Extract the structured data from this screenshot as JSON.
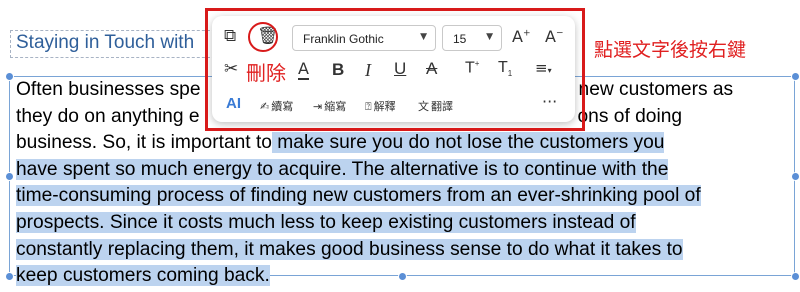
{
  "slide": {
    "title": "Staying in Touch with",
    "body_lines": [
      {
        "pre": "Often businesses spe",
        "sel": "",
        "post": "new customers as",
        "gap": true
      },
      {
        "pre": "they do on anything e",
        "sel": "",
        "post": "ons of doing",
        "gap": true
      },
      {
        "pre": "business. So, it is important to",
        "sel": " make sure you do not lose the customers you",
        "post": ""
      },
      {
        "pre": "",
        "sel": "have spent so much energy to acquire. The alternative is to continue with the",
        "post": ""
      },
      {
        "pre": "",
        "sel": "time-consuming process of finding new customers from an ever-shrinking pool of",
        "post": ""
      },
      {
        "pre": "",
        "sel": "prospects. Since it costs much less to keep existing customers instead of",
        "post": ""
      },
      {
        "pre": "",
        "sel": "constantly replacing them, it makes good business sense to do what it takes to",
        "post": ""
      },
      {
        "pre": "",
        "sel": "keep customers coming back.",
        "post": ""
      }
    ]
  },
  "toolbar": {
    "font_name": "Franklin Gothic",
    "font_size": "15",
    "icons": {
      "copy": "copy-icon",
      "delete": "trash-icon",
      "cut": "scissors-icon",
      "underline_color": "font-color-icon",
      "bold": "B",
      "italic": "I",
      "underline": "U",
      "strikethrough": "A",
      "superscript": "superscript-icon",
      "subscript": "subscript-icon",
      "align": "align-icon",
      "grow": "A+",
      "shrink": "A-",
      "ai": "AI",
      "more": "···"
    },
    "ai_actions": [
      "續寫",
      "縮寫",
      "解釋",
      "翻譯"
    ]
  },
  "annotations": {
    "delete_label": "刪除",
    "instruction": "點選文字後按右鍵",
    "highlight_color": "#d81a1a"
  }
}
